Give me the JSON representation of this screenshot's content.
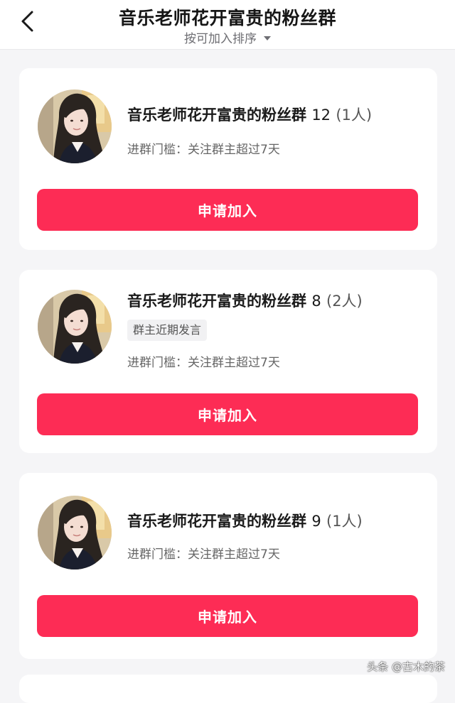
{
  "header": {
    "title": "音乐老师花开富贵的粉丝群",
    "sort_label": "按可加入排序"
  },
  "groups": [
    {
      "name": "音乐老师花开富贵的粉丝群",
      "number": "12",
      "member_count": "(1人)",
      "tag": "",
      "threshold": "进群门槛：关注群主超过7天",
      "button": "申请加入"
    },
    {
      "name": "音乐老师花开富贵的粉丝群",
      "number": "8",
      "member_count": "(2人)",
      "tag": "群主近期发言",
      "threshold": "进群门槛：关注群主超过7天",
      "button": "申请加入"
    },
    {
      "name": "音乐老师花开富贵的粉丝群",
      "number": "9",
      "member_count": "(1人)",
      "tag": "",
      "threshold": "进群门槛：关注群主超过7天",
      "button": "申请加入"
    }
  ],
  "watermark": "头条 @古木的茶",
  "colors": {
    "accent": "#fd2c55",
    "background": "#f5f5f7",
    "card": "#ffffff"
  },
  "icons": {
    "back": "chevron-left-icon",
    "sort": "caret-down-icon"
  }
}
